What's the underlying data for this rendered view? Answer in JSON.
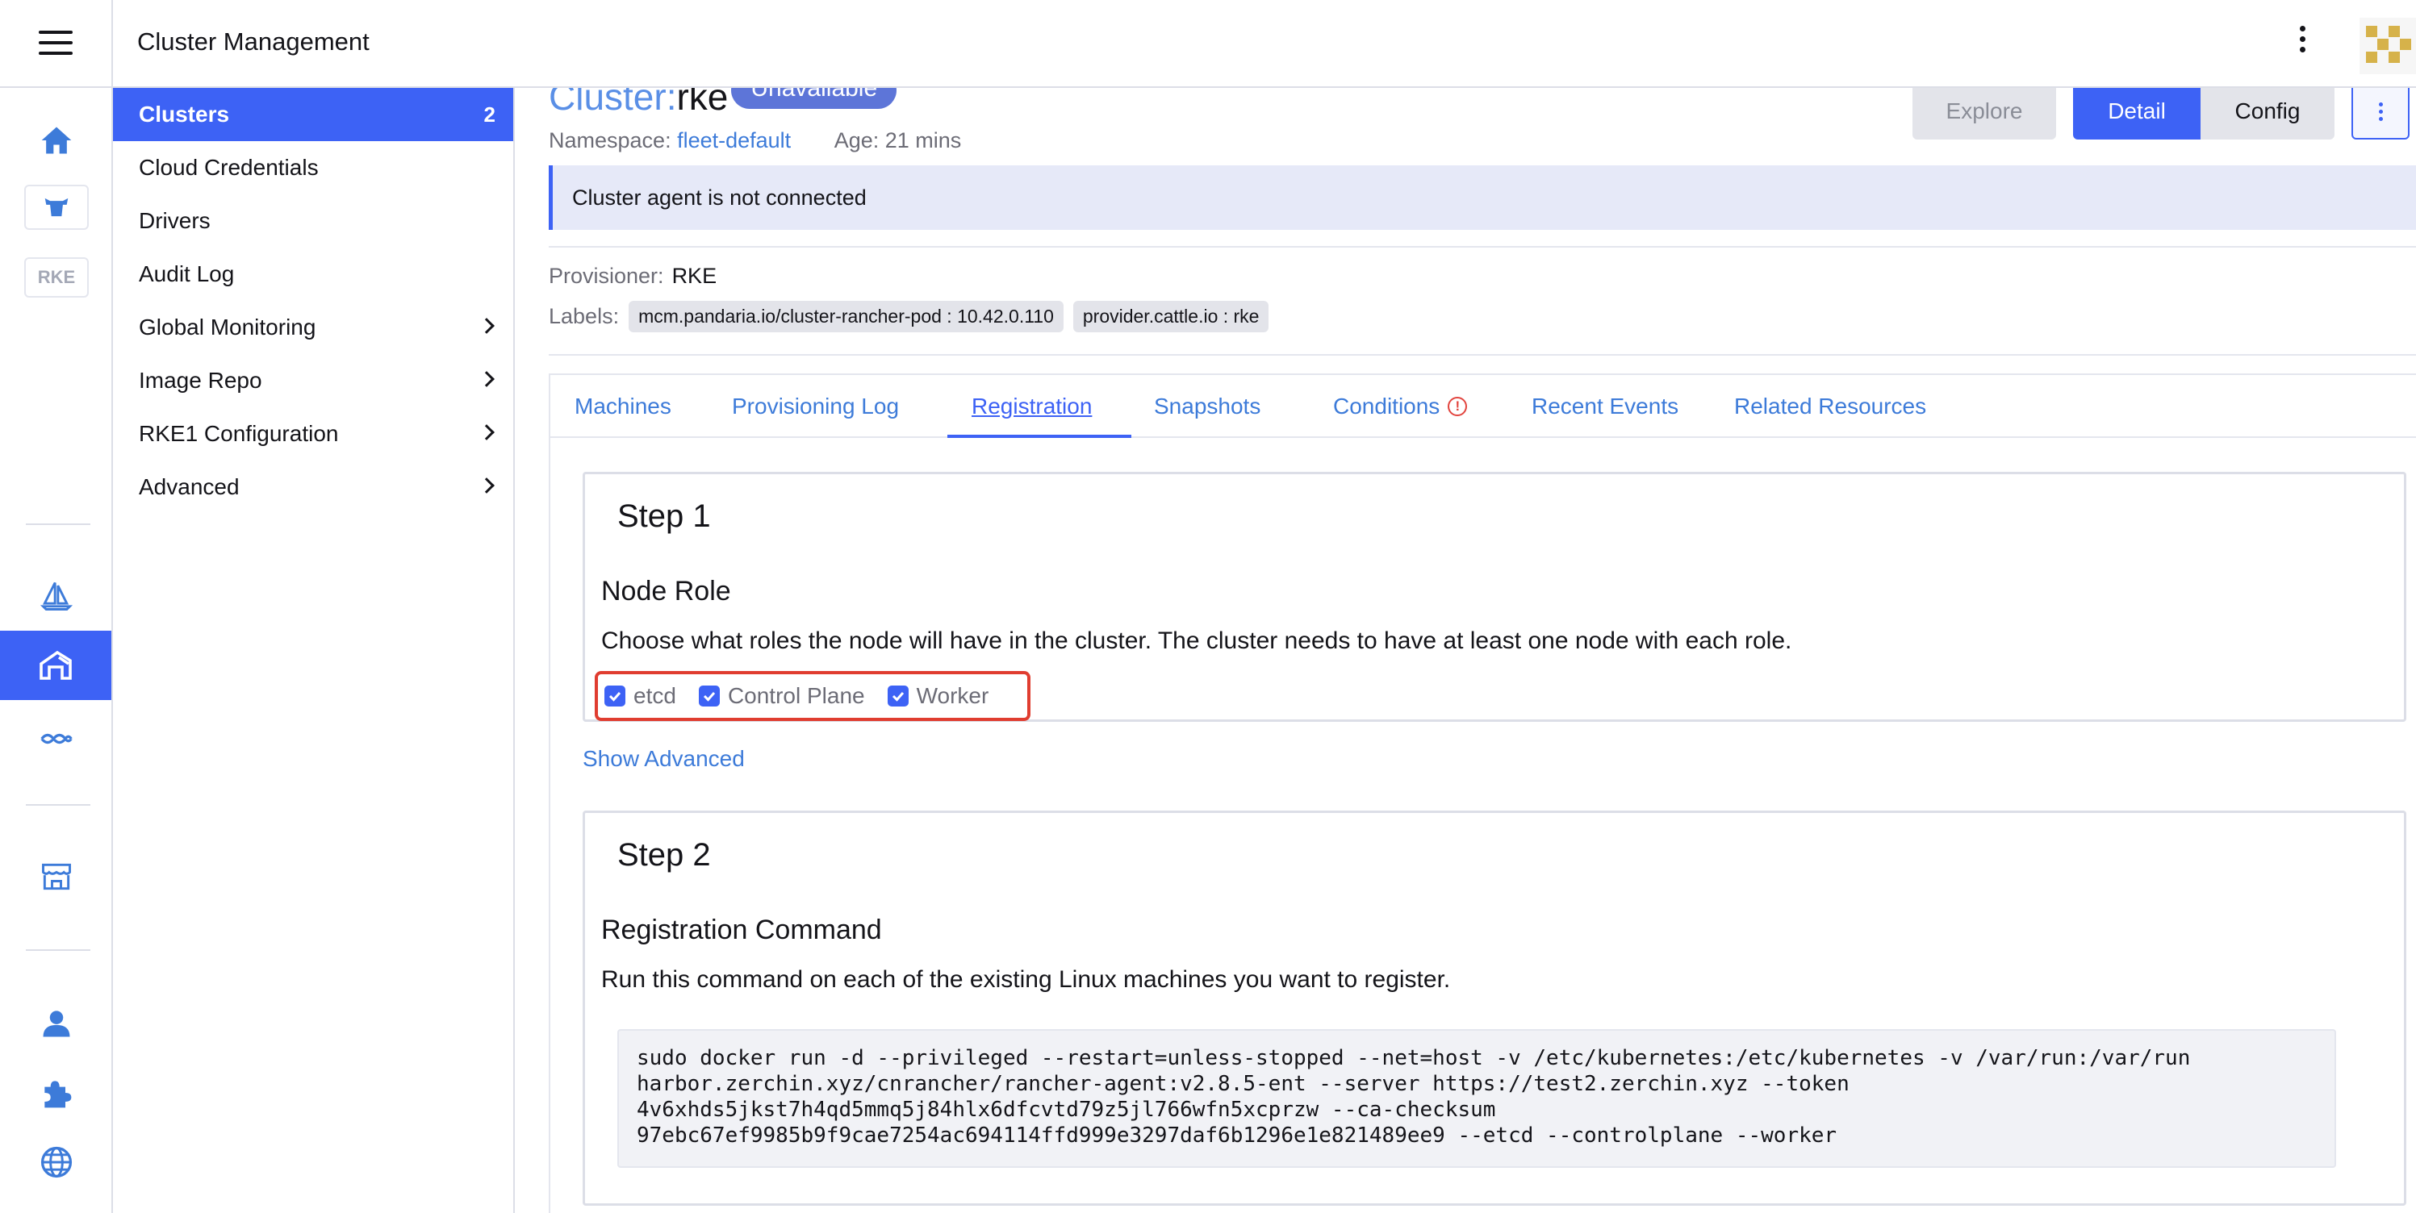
{
  "header": {
    "title": "Cluster Management"
  },
  "rail": {
    "rke_label": "RKE"
  },
  "sidebar": {
    "items": [
      {
        "label": "Clusters",
        "count": "2"
      },
      {
        "label": "Cloud Credentials"
      },
      {
        "label": "Drivers"
      },
      {
        "label": "Audit Log"
      },
      {
        "label": "Global Monitoring"
      },
      {
        "label": "Image Repo"
      },
      {
        "label": "RKE1 Configuration"
      },
      {
        "label": "Advanced"
      }
    ]
  },
  "cluster": {
    "prefix": "Cluster:",
    "name": "rke",
    "status": "Unavailable",
    "namespace_label": "Namespace:",
    "namespace": "fleet-default",
    "age": "Age: 21 mins"
  },
  "actions": {
    "explore": "Explore",
    "detail": "Detail",
    "config": "Config"
  },
  "banner": "Cluster agent is not connected",
  "details": {
    "provisioner_label": "Provisioner:",
    "provisioner": "RKE",
    "labels_label": "Labels:",
    "labels": [
      "mcm.pandaria.io/cluster-rancher-pod : 10.42.0.110",
      "provider.cattle.io : rke"
    ]
  },
  "tabs": [
    "Machines",
    "Provisioning Log",
    "Registration",
    "Snapshots",
    "Conditions",
    "Recent Events",
    "Related Resources"
  ],
  "step1": {
    "title": "Step 1",
    "subtitle": "Node Role",
    "description": "Choose what roles the node will have in the cluster. The cluster needs to have at least one node with each role.",
    "roles": [
      "etcd",
      "Control Plane",
      "Worker"
    ]
  },
  "show_advanced": "Show Advanced",
  "step2": {
    "title": "Step 2",
    "subtitle": "Registration Command",
    "description": "Run this command on each of the existing Linux machines you want to register.",
    "command": "sudo docker run -d --privileged --restart=unless-stopped --net=host -v /etc/kubernetes:/etc/kubernetes -v /var/run:/var/run\nharbor.zerchin.xyz/cnrancher/rancher-agent:v2.8.5-ent --server https://test2.zerchin.xyz --token\n4v6xhds5jkst7h4qd5mmq5j84hlx6dfcvtd79z5jl766wfn5xcprzw --ca-checksum\n97ebc67ef9985b9f9cae7254ac694114ffd999e3297daf6b1296e1e821489ee9 --etcd --controlplane --worker"
  },
  "colors": {
    "accent": "#3d62f5",
    "link": "#3d7bd9",
    "badge": "#5d75d8",
    "alert": "#e2443e",
    "highlight": "#e03d30"
  },
  "icons": [
    "hamburger-icon",
    "home-icon",
    "cow-icon",
    "sail-icon",
    "cluster-icon",
    "fleet-icon",
    "store-icon",
    "user-icon",
    "extension-icon",
    "globe-icon"
  ]
}
